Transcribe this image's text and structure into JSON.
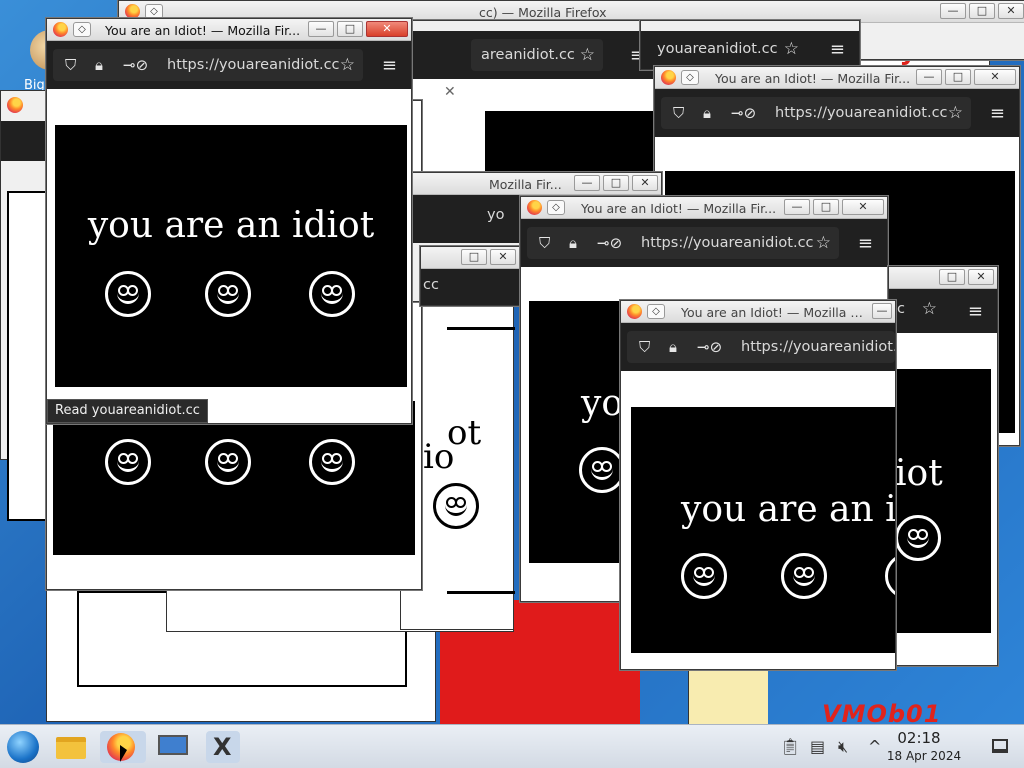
{
  "desktop": {
    "icon_label": "Big",
    "red_sign_text": "tally",
    "watermark": "VMOb01",
    "background_color": "#2a7ad0"
  },
  "browser": {
    "window_title": "You are an Idiot! — Mozilla Fir...",
    "window_title_full": "cc) — Mozilla Firefox",
    "window_title_partial": "e an Idiot! — Mozilla Fir...",
    "window_title_short": "Mozilla Fir...",
    "url": "https://youareanidiot.cc",
    "url_partial_1": "youareanidiot.cc",
    "url_partial_2": "areanidiot.cc",
    "url_partial_3": "yo",
    "url_partial_4": "cc",
    "status_link": "Read youareanidiot.cc",
    "minimize_label": "—",
    "maximize_label": "□",
    "close_label": "✕",
    "pin_label": "◇"
  },
  "page": {
    "headline": "you are an idiot",
    "headline_partial_1": "you are an idi",
    "headline_partial_2": "iot",
    "headline_partial_3": "ot",
    "headline_partial_4": "io",
    "headline_partial_5": "yo"
  },
  "taskbar": {
    "time": "02:18",
    "date": "18 Apr 2024",
    "apps": [
      "start-menu",
      "file-manager",
      "firefox",
      "system-settings",
      "xfce-terminal"
    ]
  }
}
